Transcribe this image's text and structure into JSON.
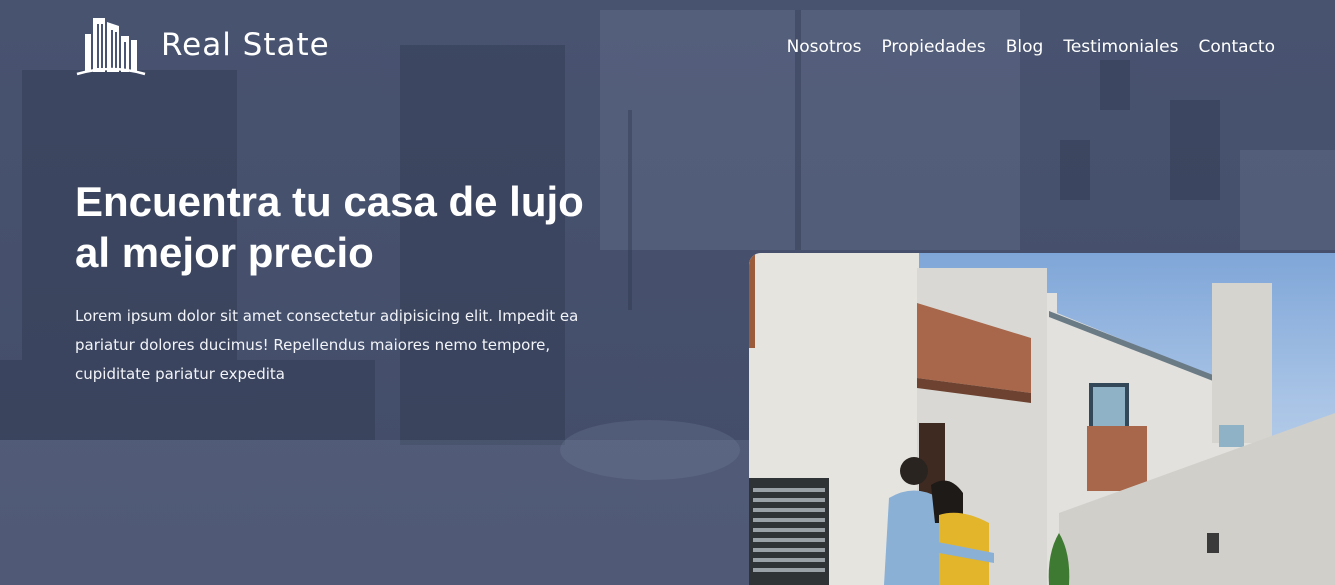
{
  "brand": {
    "name": "Real State",
    "icon": "buildings-logo-icon"
  },
  "nav": {
    "items": [
      {
        "label": "Nosotros"
      },
      {
        "label": "Propiedades"
      },
      {
        "label": "Blog"
      },
      {
        "label": "Testimoniales"
      },
      {
        "label": "Contacto"
      }
    ]
  },
  "hero": {
    "title_line1": "Encuentra tu casa de lujo",
    "title_line2": "al mejor precio",
    "text": "Lorem ipsum dolor sit amet consectetur adipisicing elit. Impedit ea pariatur dolores ducimus! Repellendus maiores nemo tempore, cupiditate pariatur expedita"
  },
  "colors": {
    "overlay": "#4a5573",
    "text": "#ffffff"
  }
}
